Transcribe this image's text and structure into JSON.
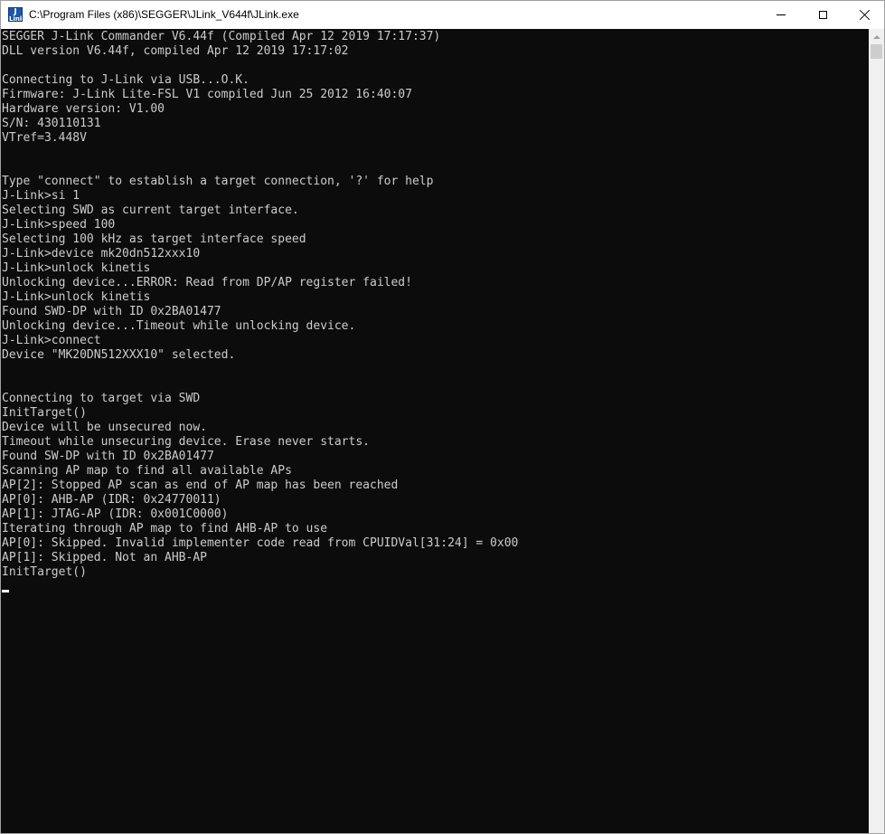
{
  "window": {
    "title": "C:\\Program Files (x86)\\SEGGER\\JLink_V644f\\JLink.exe",
    "icon": "jlink-app-icon"
  },
  "colors": {
    "console_bg": "#0c0c0c",
    "console_fg": "#cccccc",
    "titlebar_bg": "#ffffff"
  },
  "console": {
    "lines": [
      "SEGGER J-Link Commander V6.44f (Compiled Apr 12 2019 17:17:37)",
      "DLL version V6.44f, compiled Apr 12 2019 17:17:02",
      "",
      "Connecting to J-Link via USB...O.K.",
      "Firmware: J-Link Lite-FSL V1 compiled Jun 25 2012 16:40:07",
      "Hardware version: V1.00",
      "S/N: 430110131",
      "VTref=3.448V",
      "",
      "",
      "Type \"connect\" to establish a target connection, '?' for help",
      "J-Link>si 1",
      "Selecting SWD as current target interface.",
      "J-Link>speed 100",
      "Selecting 100 kHz as target interface speed",
      "J-Link>device mk20dn512xxx10",
      "J-Link>unlock kinetis",
      "Unlocking device...ERROR: Read from DP/AP register failed!",
      "J-Link>unlock kinetis",
      "Found SWD-DP with ID 0x2BA01477",
      "Unlocking device...Timeout while unlocking device.",
      "J-Link>connect",
      "Device \"MK20DN512XXX10\" selected.",
      "",
      "",
      "Connecting to target via SWD",
      "InitTarget()",
      "Device will be unsecured now.",
      "Timeout while unsecuring device. Erase never starts.",
      "Found SW-DP with ID 0x2BA01477",
      "Scanning AP map to find all available APs",
      "AP[2]: Stopped AP scan as end of AP map has been reached",
      "AP[0]: AHB-AP (IDR: 0x24770011)",
      "AP[1]: JTAG-AP (IDR: 0x001C0000)",
      "Iterating through AP map to find AHB-AP to use",
      "AP[0]: Skipped. Invalid implementer code read from CPUIDVal[31:24] = 0x00",
      "AP[1]: Skipped. Not an AHB-AP",
      "InitTarget()",
      ""
    ]
  }
}
